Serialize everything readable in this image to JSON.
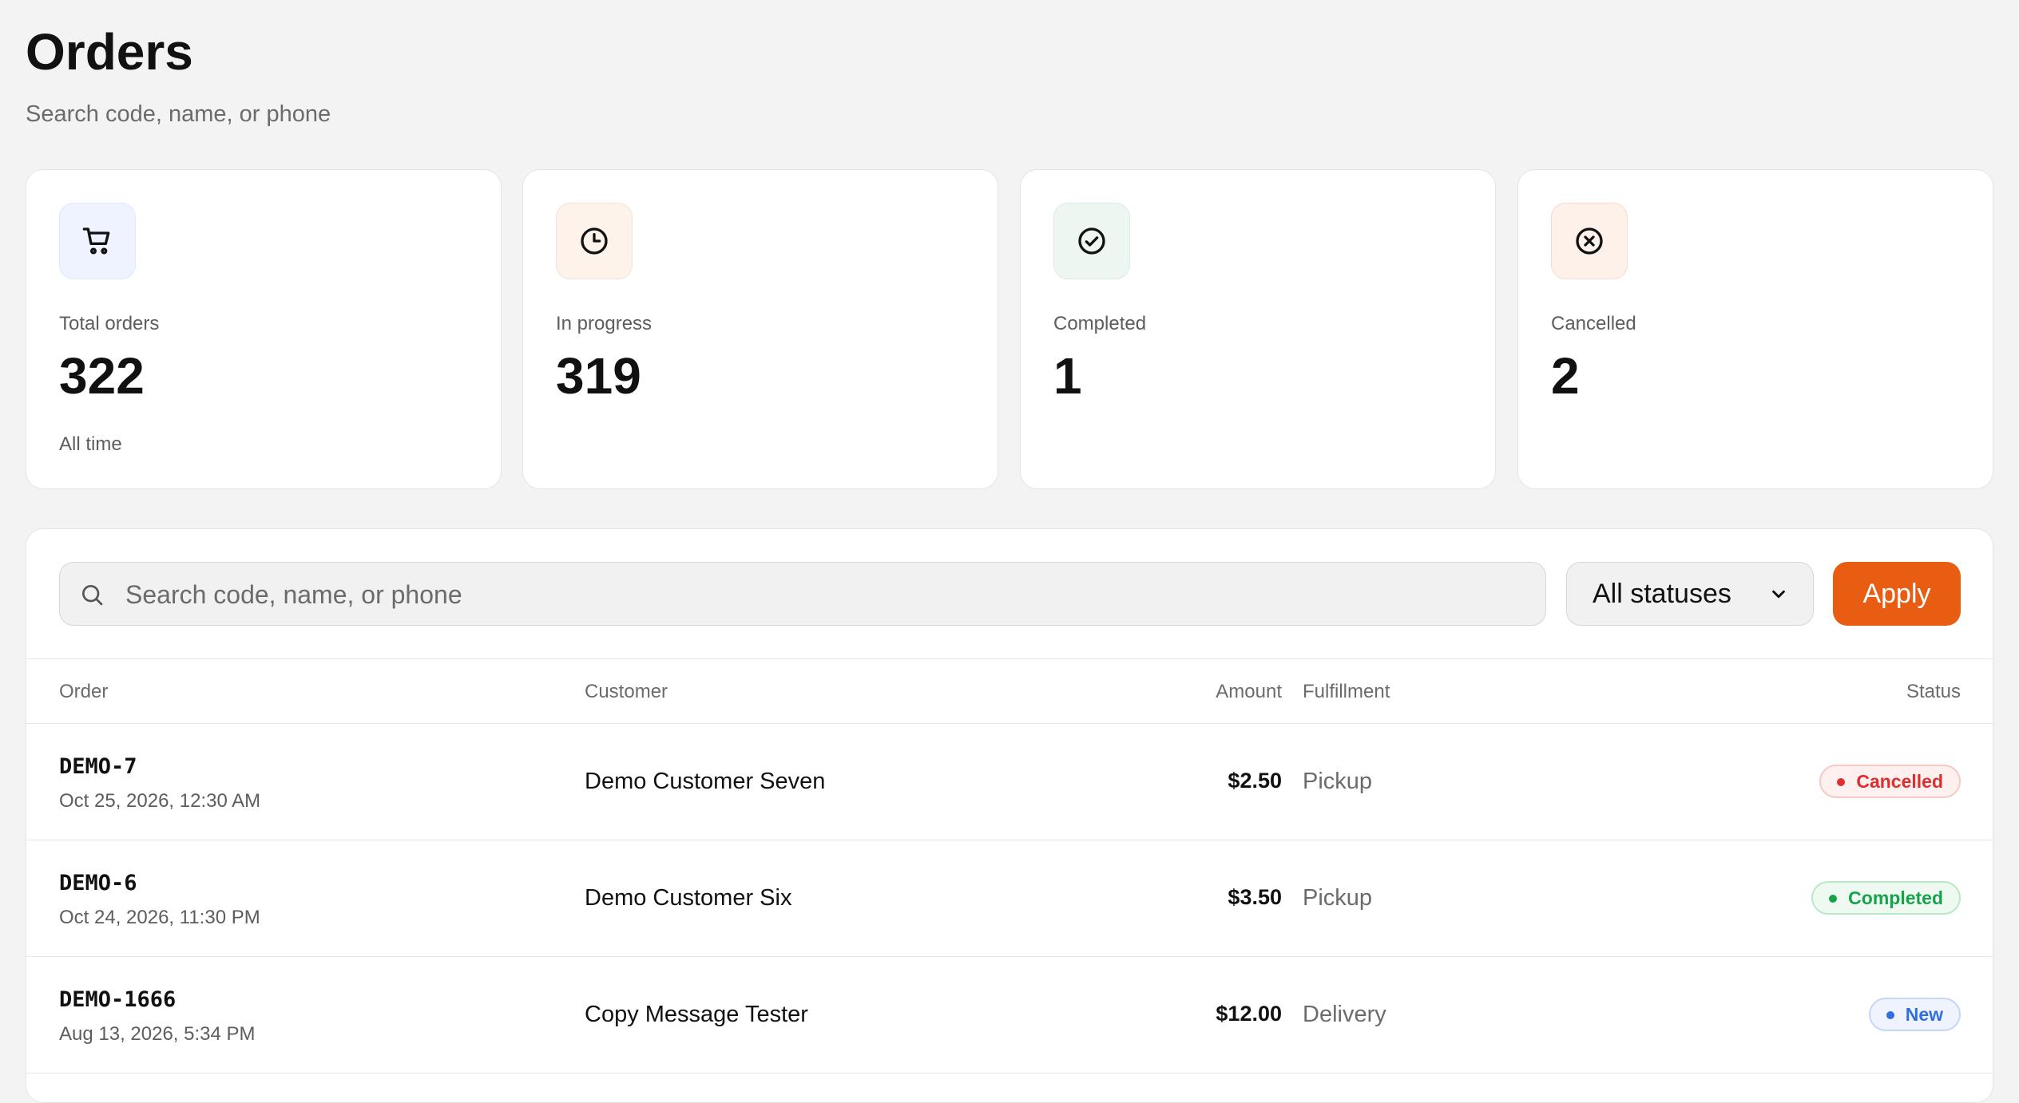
{
  "header": {
    "title": "Orders",
    "subtitle": "Search code, name, or phone"
  },
  "stats": [
    {
      "icon": "cart-icon",
      "label": "Total orders",
      "value": "322",
      "note": "All time",
      "bg": "#eef3ff",
      "border": "#dfe7fb"
    },
    {
      "icon": "clock-icon",
      "label": "In progress",
      "value": "319",
      "note": "",
      "bg": "#fdf3ea",
      "border": "#f6e0cf"
    },
    {
      "icon": "check-circle-icon",
      "label": "Completed",
      "value": "1",
      "note": "",
      "bg": "#edf6f1",
      "border": "#dcebe2"
    },
    {
      "icon": "x-circle-icon",
      "label": "Cancelled",
      "value": "2",
      "note": "",
      "bg": "#fdf1ea",
      "border": "#f6dccd"
    }
  ],
  "filters": {
    "search_placeholder": "Search code, name, or phone",
    "search_value": "",
    "status_selected": "All statuses",
    "apply_label": "Apply",
    "apply_color": "#e85d12"
  },
  "table": {
    "columns": {
      "order": "Order",
      "customer": "Customer",
      "amount": "Amount",
      "fulfillment": "Fulfillment",
      "status": "Status"
    },
    "rows": [
      {
        "code": "DEMO-7",
        "date": "Oct 25, 2026, 12:30 AM",
        "customer": "Demo Customer Seven",
        "amount": "$2.50",
        "fulfillment": "Pickup",
        "status": "Cancelled"
      },
      {
        "code": "DEMO-6",
        "date": "Oct 24, 2026, 11:30 PM",
        "customer": "Demo Customer Six",
        "amount": "$3.50",
        "fulfillment": "Pickup",
        "status": "Completed"
      },
      {
        "code": "DEMO-1666",
        "date": "Aug 13, 2026, 5:34 PM",
        "customer": "Copy Message Tester",
        "amount": "$12.00",
        "fulfillment": "Delivery",
        "status": "New"
      }
    ]
  },
  "status_colors": {
    "Cancelled": {
      "text": "#e02d2d",
      "bg": "#fdf0ee",
      "border": "#f6c9c3"
    },
    "Completed": {
      "text": "#16a34a",
      "bg": "#eefaf1",
      "border": "#b9e8c6"
    },
    "New": {
      "text": "#2f6fde",
      "bg": "#eef3fd",
      "border": "#c6d6f5"
    }
  }
}
